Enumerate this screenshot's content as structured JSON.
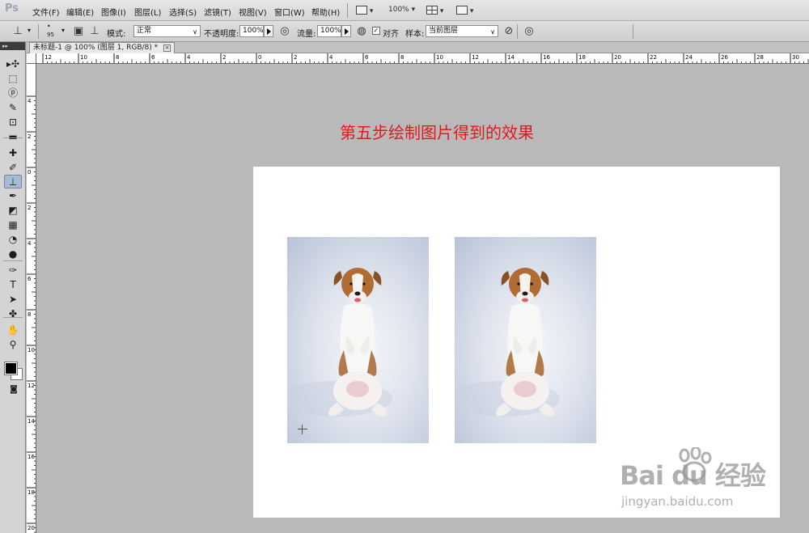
{
  "app": {
    "logo": "Ps"
  },
  "menu": [
    {
      "label": "文件(F)"
    },
    {
      "label": "编辑(E)"
    },
    {
      "label": "图像(I)"
    },
    {
      "label": "图层(L)"
    },
    {
      "label": "选择(S)"
    },
    {
      "label": "滤镜(T)"
    },
    {
      "label": "视图(V)"
    },
    {
      "label": "窗口(W)"
    },
    {
      "label": "帮助(H)"
    }
  ],
  "menubar_controls": {
    "zoom": "100%"
  },
  "options": {
    "brush_size": "95",
    "mode_label": "模式:",
    "mode_value": "正常",
    "opacity_label": "不透明度:",
    "opacity_value": "100%",
    "flow_label": "流量:",
    "flow_value": "100%",
    "aligned_label": "对齐",
    "aligned_checked": true,
    "sample_label": "样本:",
    "sample_value": "当前图层"
  },
  "document_tab": {
    "title": "未标题-1 @ 100% (图层 1, RGB/8) *",
    "close": "×"
  },
  "ruler": {
    "top_labels": [
      "12",
      "10",
      "8",
      "6",
      "4",
      "2",
      "0",
      "2",
      "4",
      "6",
      "8",
      "10",
      "12",
      "14",
      "16",
      "18",
      "20",
      "22",
      "24",
      "26",
      "28",
      "30"
    ],
    "left_labels": [
      "4",
      "2",
      "0",
      "2",
      "4",
      "6",
      "8",
      "10",
      "12",
      "14",
      "16",
      "18",
      "20"
    ]
  },
  "canvas": {
    "headline": "第五步绘制图片得到的效果",
    "headline_color": "#e0191f"
  },
  "watermark": {
    "logo": "Bai du 经验",
    "url": "jingyan.baidu.com"
  },
  "tools": [
    {
      "icon": "move-tool-icon",
      "glyph": "▸✣"
    },
    {
      "icon": "marquee-tool-icon",
      "glyph": "⬚"
    },
    {
      "icon": "lasso-tool-icon",
      "glyph": "ⓟ"
    },
    {
      "icon": "quick-select-tool-icon",
      "glyph": "✎"
    },
    {
      "icon": "crop-tool-icon",
      "glyph": "⊡"
    },
    {
      "icon": "ruler-tool-icon",
      "glyph": "▬"
    },
    {
      "icon": "healing-brush-tool-icon",
      "glyph": "✚"
    },
    {
      "icon": "brush-tool-icon",
      "glyph": "✐"
    },
    {
      "icon": "clone-stamp-tool-icon",
      "glyph": "⊥"
    },
    {
      "icon": "history-brush-tool-icon",
      "glyph": "✒"
    },
    {
      "icon": "eraser-tool-icon",
      "glyph": "◩"
    },
    {
      "icon": "gradient-tool-icon",
      "glyph": "▦"
    },
    {
      "icon": "blur-tool-icon",
      "glyph": "◔"
    },
    {
      "icon": "dodge-tool-icon",
      "glyph": "●"
    },
    {
      "icon": "pen-tool-icon",
      "glyph": "✑"
    },
    {
      "icon": "type-tool-icon",
      "glyph": "T"
    },
    {
      "icon": "path-select-tool-icon",
      "glyph": "➤"
    },
    {
      "icon": "shape-tool-icon",
      "glyph": "✤"
    },
    {
      "icon": "hand-tool-icon",
      "glyph": "✋"
    },
    {
      "icon": "zoom-tool-icon",
      "glyph": "⚲"
    }
  ],
  "active_tool": "clone-stamp-tool-icon"
}
